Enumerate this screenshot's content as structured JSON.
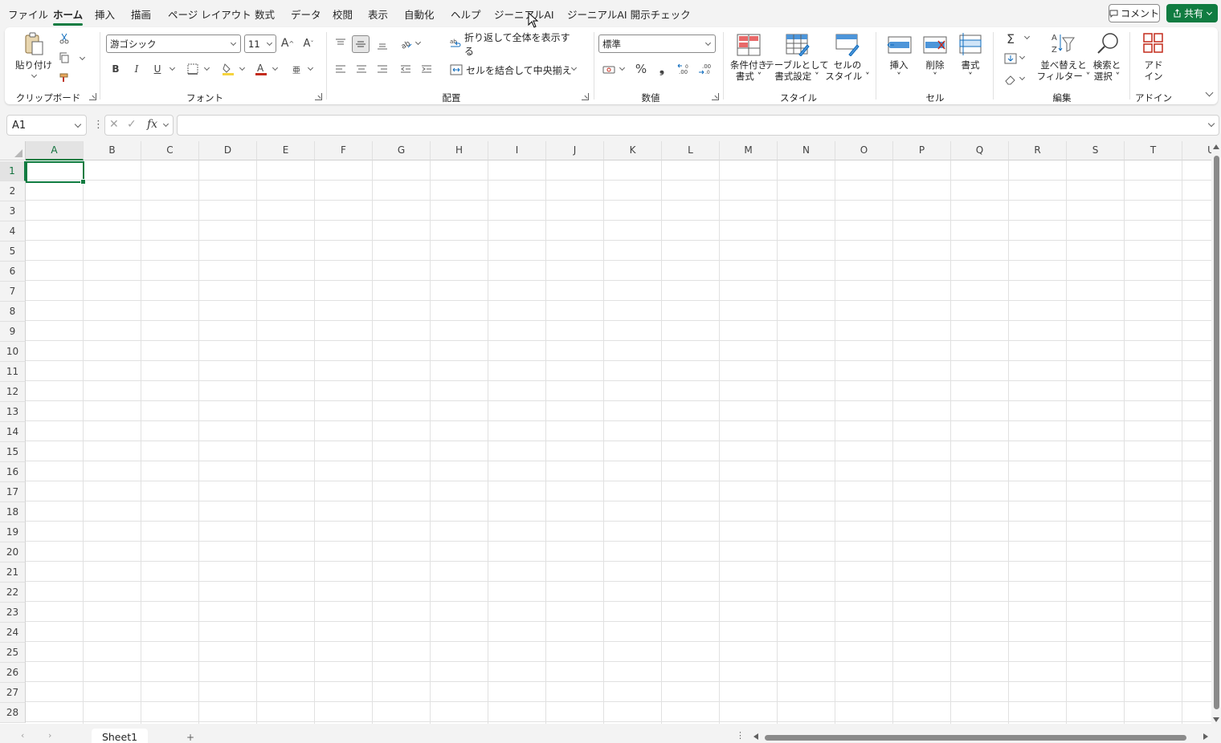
{
  "menu": {
    "items": [
      "ファイル",
      "ホーム",
      "挿入",
      "描画",
      "ページ レイアウト",
      "数式",
      "データ",
      "校閲",
      "表示",
      "自動化",
      "ヘルプ",
      "ジーニアルAI",
      "ジーニアルAI 開示チェック"
    ],
    "active": "ホーム",
    "comment_label": "コメント",
    "share_label": "共有"
  },
  "ribbon": {
    "clipboard": {
      "paste_label": "貼り付け",
      "group_label": "クリップボード"
    },
    "font": {
      "font_name": "游ゴシック",
      "font_size": "11",
      "group_label": "フォント",
      "grow_label": "A^",
      "shrink_label": "Aˇ",
      "bold": "B",
      "italic": "I",
      "underline": "U"
    },
    "alignment": {
      "wrap_label": "折り返して全体を表示する",
      "merge_label": "セルを結合して中央揃え",
      "group_label": "配置"
    },
    "number": {
      "format": "標準",
      "group_label": "数値",
      "percent": "%",
      "comma": "❟"
    },
    "styles": {
      "conditional_label_1": "条件付き",
      "conditional_label_2": "書式",
      "table_label_1": "テーブルとして",
      "table_label_2": "書式設定",
      "cell_label_1": "セルの",
      "cell_label_2": "スタイル",
      "group_label": "スタイル"
    },
    "cells": {
      "insert_label": "挿入",
      "delete_label": "削除",
      "format_label": "書式",
      "group_label": "セル"
    },
    "editing": {
      "sort_label_1": "並べ替えと",
      "sort_label_2": "フィルター",
      "find_label_1": "検索と",
      "find_label_2": "選択",
      "group_label": "編集"
    },
    "addins": {
      "label_1": "アド",
      "label_2": "イン",
      "group_label": "アドイン"
    }
  },
  "formula_bar": {
    "name_box": "A1",
    "fx": "fx",
    "value": ""
  },
  "grid": {
    "columns": [
      "A",
      "B",
      "C",
      "D",
      "E",
      "F",
      "G",
      "H",
      "I",
      "J",
      "K",
      "L",
      "M",
      "N",
      "O",
      "P",
      "Q",
      "R",
      "S",
      "T",
      "U"
    ],
    "rows": [
      "1",
      "2",
      "3",
      "4",
      "5",
      "6",
      "7",
      "8",
      "9",
      "10",
      "11",
      "12",
      "13",
      "14",
      "15",
      "16",
      "17",
      "18",
      "19",
      "20",
      "21",
      "22",
      "23",
      "24",
      "25",
      "26",
      "27",
      "28"
    ],
    "selected_cell": "A1"
  },
  "sheets": {
    "tabs": [
      "Sheet1"
    ],
    "active": "Sheet1"
  },
  "colors": {
    "accent": "#107c41"
  }
}
